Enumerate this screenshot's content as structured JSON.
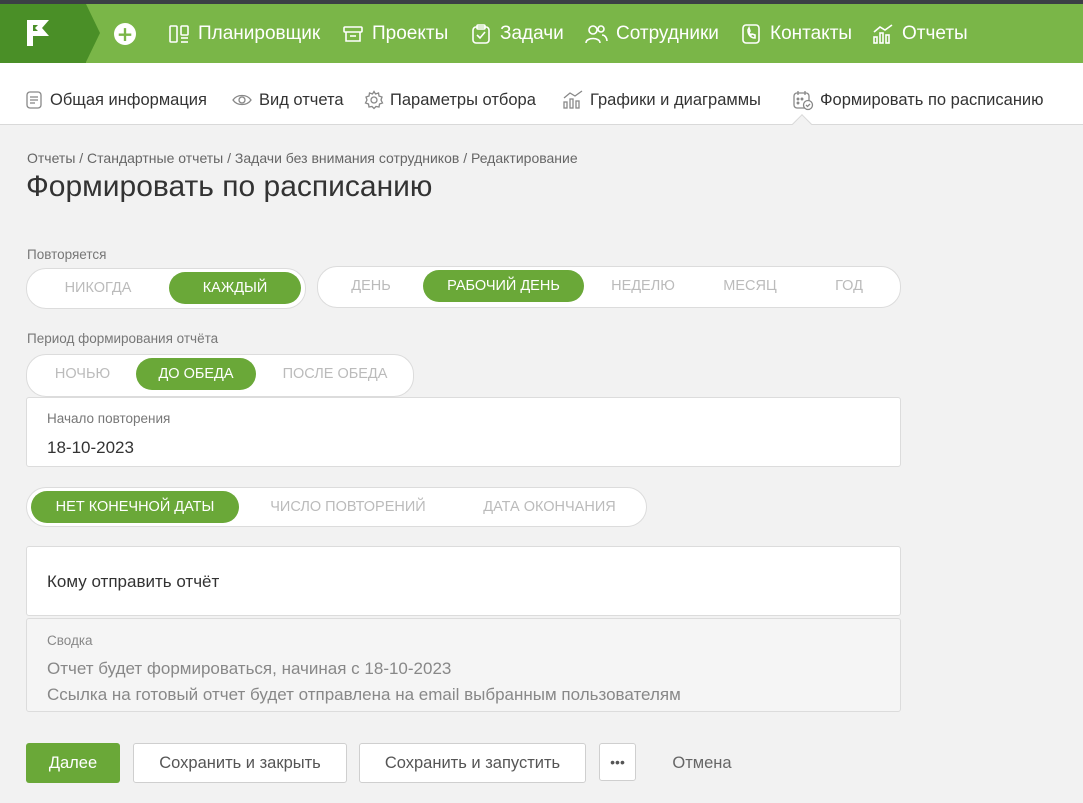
{
  "nav": {
    "plus": "+",
    "items": [
      {
        "label": "Планировщик",
        "icon": "planner-icon"
      },
      {
        "label": "Проекты",
        "icon": "projects-icon"
      },
      {
        "label": "Задачи",
        "icon": "tasks-icon"
      },
      {
        "label": "Сотрудники",
        "icon": "employees-icon"
      },
      {
        "label": "Контакты",
        "icon": "contacts-icon"
      },
      {
        "label": "Отчеты",
        "icon": "reports-icon"
      }
    ]
  },
  "subtabs": [
    {
      "label": "Общая информация",
      "icon": "document-icon"
    },
    {
      "label": "Вид отчета",
      "icon": "eye-icon"
    },
    {
      "label": "Параметры отбора",
      "icon": "gear-icon"
    },
    {
      "label": "Графики и диаграммы",
      "icon": "chart-icon"
    },
    {
      "label": "Формировать по расписанию",
      "icon": "calendar-icon"
    }
  ],
  "breadcrumb": "Отчеты / Стандартные отчеты / Задачи без внимания сотрудников / Редактирование",
  "title": "Формировать по расписанию",
  "repeat": {
    "label": "Повторяется",
    "mode": [
      "Никогда",
      "Каждый"
    ],
    "unit": [
      "День",
      "Рабочий день",
      "Неделю",
      "Месяц",
      "Год"
    ]
  },
  "period": {
    "label": "Период формирования отчёта",
    "options": [
      "Ночью",
      "До обеда",
      "После обеда"
    ]
  },
  "start": {
    "label": "Начало повторения",
    "value": "18-10-2023"
  },
  "end": {
    "options": [
      "Нет конечной даты",
      "Число повторений",
      "Дата окончания"
    ]
  },
  "recipients": {
    "label": "Кому отправить отчёт"
  },
  "summary": {
    "title": "Сводка",
    "line1": "Отчет будет формироваться, начиная с 18-10-2023",
    "line2": "Ссылка на готовый отчет будет отправлена на email выбранным пользователям"
  },
  "buttons": {
    "next": "Далее",
    "save_close": "Сохранить и закрыть",
    "save_run": "Сохранить и запустить",
    "more": "•••",
    "cancel": "Отмена"
  },
  "colors": {
    "nav_bg": "#7ab648",
    "logo_bg": "#4a8f27",
    "accent": "#6aa838"
  }
}
